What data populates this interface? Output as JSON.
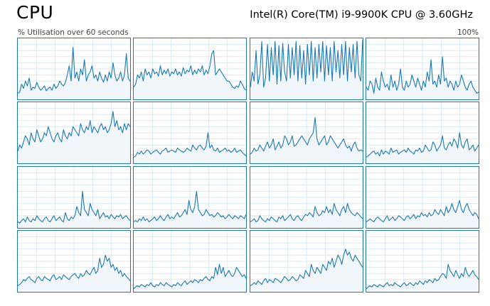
{
  "header": {
    "title": "CPU",
    "cpu_name": "Intel(R) Core(TM) i9-9900K CPU @ 3.60GHz",
    "y_axis_label": "% Utilisation over 60 seconds",
    "y_axis_max": "100%"
  },
  "colors": {
    "accent": "#1c79b3",
    "fill": "#f1f6fb",
    "grid": "#d9eaf5"
  },
  "chart_data": {
    "type": "area",
    "ylim": [
      0,
      100
    ],
    "xlim": [
      0,
      60
    ],
    "grid": true,
    "logical_processors": [
      {
        "values": [
          10,
          12,
          25,
          18,
          30,
          22,
          35,
          15,
          20,
          18,
          28,
          20,
          15,
          18,
          22,
          14,
          18,
          20,
          15,
          25,
          18,
          22,
          30,
          25,
          22,
          28,
          40,
          55,
          30,
          85,
          35,
          45,
          30,
          50,
          40,
          65,
          30,
          40,
          45,
          55,
          35,
          40,
          30,
          45,
          35,
          28,
          40,
          30,
          45,
          35,
          60,
          40,
          30,
          35,
          45,
          30,
          40,
          75,
          35,
          30
        ]
      },
      {
        "values": [
          20,
          25,
          40,
          35,
          45,
          30,
          50,
          40,
          45,
          35,
          50,
          42,
          45,
          38,
          55,
          40,
          48,
          42,
          50,
          38,
          45,
          42,
          50,
          40,
          45,
          38,
          52,
          42,
          48,
          45,
          55,
          40,
          48,
          42,
          50,
          45,
          55,
          40,
          48,
          42,
          55,
          75,
          80,
          40,
          45,
          50,
          45,
          40,
          35,
          30,
          30,
          25,
          20,
          18,
          22,
          20,
          30,
          25,
          18,
          15
        ]
      },
      {
        "values": [
          20,
          45,
          30,
          80,
          25,
          40,
          95,
          20,
          35,
          90,
          30,
          85,
          40,
          95,
          25,
          88,
          30,
          92,
          45,
          30,
          90,
          35,
          85,
          40,
          95,
          30,
          88,
          35,
          80,
          25,
          90,
          40,
          95,
          30,
          85,
          35,
          90,
          45,
          95,
          30,
          88,
          40,
          85,
          30,
          95,
          45,
          80,
          35,
          90,
          40,
          95,
          30,
          85,
          45,
          90,
          35,
          95,
          40,
          30,
          98
        ]
      },
      {
        "values": [
          20,
          15,
          30,
          25,
          10,
          35,
          20,
          15,
          45,
          30,
          20,
          25,
          15,
          40,
          20,
          30,
          15,
          25,
          50,
          20,
          15,
          30,
          20,
          25,
          40,
          30,
          20,
          35,
          25,
          15,
          30,
          20,
          45,
          30,
          65,
          25,
          30,
          20,
          40,
          25,
          70,
          30,
          35,
          20,
          30,
          25,
          15,
          30,
          20,
          25,
          40,
          30,
          20,
          15,
          25,
          30,
          20,
          15,
          10,
          12
        ]
      },
      {
        "values": [
          20,
          30,
          25,
          35,
          45,
          40,
          30,
          50,
          40,
          35,
          55,
          45,
          35,
          40,
          50,
          45,
          60,
          50,
          40,
          35,
          45,
          50,
          40,
          35,
          55,
          45,
          40,
          50,
          45,
          60,
          55,
          50,
          45,
          65,
          55,
          50,
          60,
          55,
          70,
          50,
          60,
          55,
          50,
          60,
          65,
          55,
          60,
          50,
          55,
          65,
          85,
          60,
          70,
          55,
          60,
          50,
          65,
          55,
          65,
          60
        ]
      },
      {
        "values": [
          10,
          12,
          18,
          15,
          20,
          15,
          18,
          22,
          20,
          15,
          18,
          20,
          22,
          18,
          15,
          20,
          22,
          25,
          18,
          20,
          22,
          20,
          18,
          25,
          22,
          20,
          18,
          20,
          25,
          22,
          20,
          30,
          25,
          22,
          28,
          30,
          25,
          22,
          28,
          50,
          25,
          30,
          22,
          20,
          25,
          18,
          20,
          22,
          25,
          20,
          22,
          18,
          20,
          25,
          18,
          20,
          22,
          18,
          15,
          12
        ]
      },
      {
        "values": [
          15,
          18,
          25,
          20,
          22,
          30,
          25,
          20,
          28,
          35,
          25,
          30,
          40,
          22,
          28,
          35,
          25,
          30,
          45,
          40,
          30,
          35,
          45,
          28,
          30,
          35,
          40,
          45,
          40,
          35,
          30,
          40,
          45,
          50,
          75,
          40,
          30,
          35,
          40,
          45,
          30,
          35,
          45,
          40,
          35,
          30,
          25,
          30,
          35,
          40,
          30,
          25,
          28,
          20,
          30,
          35,
          25,
          20,
          22,
          20
        ]
      },
      {
        "values": [
          10,
          12,
          15,
          18,
          20,
          15,
          18,
          12,
          22,
          15,
          20,
          18,
          15,
          25,
          18,
          20,
          22,
          15,
          18,
          20,
          22,
          18,
          25,
          20,
          18,
          15,
          22,
          20,
          25,
          18,
          20,
          30,
          25,
          20,
          22,
          35,
          30,
          20,
          25,
          30,
          45,
          25,
          22,
          30,
          35,
          28,
          40,
          35,
          25,
          50,
          30,
          25,
          35,
          40,
          22,
          25,
          30,
          20,
          25,
          30
        ]
      },
      {
        "values": [
          10,
          8,
          12,
          15,
          10,
          18,
          12,
          10,
          15,
          12,
          20,
          15,
          12,
          10,
          15,
          18,
          12,
          10,
          15,
          20,
          12,
          15,
          18,
          12,
          10,
          25,
          15,
          12,
          18,
          15,
          20,
          35,
          25,
          20,
          60,
          30,
          25,
          20,
          40,
          30,
          25,
          20,
          30,
          15,
          20,
          25,
          18,
          20,
          15,
          22,
          18,
          15,
          20,
          18,
          22,
          15,
          18,
          20,
          15,
          12
        ]
      },
      {
        "values": [
          10,
          12,
          10,
          15,
          12,
          18,
          12,
          15,
          10,
          12,
          15,
          18,
          12,
          15,
          20,
          15,
          12,
          18,
          22,
          15,
          18,
          15,
          20,
          25,
          18,
          20,
          25,
          30,
          22,
          45,
          30,
          25,
          35,
          60,
          30,
          25,
          20,
          22,
          30,
          25,
          20,
          22,
          18,
          20,
          25,
          22,
          18,
          20,
          15,
          18,
          22,
          18,
          15,
          20,
          18,
          15,
          20,
          18,
          15,
          22
        ]
      },
      {
        "values": [
          10,
          12,
          15,
          10,
          12,
          20,
          15,
          12,
          10,
          15,
          12,
          18,
          15,
          12,
          10,
          18,
          15,
          20,
          12,
          15,
          18,
          22,
          15,
          12,
          18,
          20,
          15,
          12,
          18,
          22,
          20,
          25,
          22,
          18,
          35,
          25,
          20,
          22,
          28,
          25,
          35,
          25,
          30,
          22,
          40,
          30,
          25,
          20,
          30,
          35,
          25,
          40,
          30,
          25,
          22,
          20,
          25,
          22,
          18,
          15
        ]
      },
      {
        "values": [
          10,
          12,
          15,
          12,
          10,
          15,
          18,
          15,
          12,
          10,
          15,
          20,
          12,
          15,
          18,
          12,
          15,
          20,
          18,
          15,
          12,
          18,
          20,
          15,
          18,
          22,
          15,
          20,
          18,
          25,
          20,
          22,
          18,
          25,
          20,
          22,
          30,
          25,
          22,
          30,
          25,
          20,
          35,
          25,
          30,
          40,
          30,
          25,
          35,
          45,
          30,
          25,
          35,
          40,
          30,
          25,
          20,
          25,
          22,
          15
        ]
      },
      {
        "values": [
          10,
          12,
          15,
          20,
          18,
          22,
          25,
          20,
          18,
          15,
          22,
          25,
          20,
          18,
          25,
          22,
          20,
          18,
          25,
          28,
          20,
          22,
          25,
          20,
          28,
          25,
          22,
          20,
          25,
          28,
          30,
          25,
          22,
          30,
          25,
          28,
          35,
          30,
          28,
          35,
          40,
          30,
          35,
          55,
          40,
          45,
          60,
          50,
          55,
          40,
          45,
          35,
          40,
          30,
          35,
          25,
          30,
          25,
          22,
          18
        ]
      },
      {
        "values": [
          5,
          8,
          10,
          8,
          12,
          10,
          8,
          12,
          10,
          15,
          10,
          8,
          12,
          10,
          15,
          12,
          10,
          15,
          12,
          10,
          8,
          12,
          10,
          15,
          12,
          10,
          15,
          18,
          12,
          15,
          18,
          15,
          20,
          18,
          15,
          20,
          18,
          22,
          25,
          20,
          18,
          25,
          22,
          40,
          28,
          45,
          30,
          40,
          25,
          30,
          35,
          28,
          25,
          30,
          40,
          35,
          30,
          25,
          28,
          22
        ]
      },
      {
        "values": [
          10,
          12,
          15,
          12,
          18,
          15,
          12,
          18,
          22,
          15,
          20,
          18,
          15,
          22,
          20,
          18,
          15,
          20,
          25,
          22,
          18,
          20,
          25,
          22,
          18,
          20,
          28,
          25,
          22,
          35,
          30,
          25,
          45,
          35,
          30,
          40,
          35,
          30,
          45,
          40,
          35,
          50,
          45,
          55,
          40,
          50,
          60,
          55,
          45,
          60,
          70,
          60,
          65,
          55,
          50,
          60,
          55,
          50,
          45,
          40
        ]
      },
      {
        "values": [
          5,
          8,
          10,
          8,
          12,
          10,
          8,
          12,
          10,
          8,
          12,
          15,
          10,
          12,
          10,
          15,
          12,
          10,
          8,
          12,
          15,
          10,
          12,
          15,
          12,
          10,
          15,
          12,
          18,
          15,
          12,
          18,
          15,
          20,
          18,
          15,
          22,
          18,
          20,
          25,
          30,
          28,
          22,
          45,
          35,
          30,
          25,
          35,
          28,
          22,
          30,
          25,
          40,
          30,
          25,
          30,
          35,
          28,
          25,
          20
        ]
      }
    ]
  }
}
